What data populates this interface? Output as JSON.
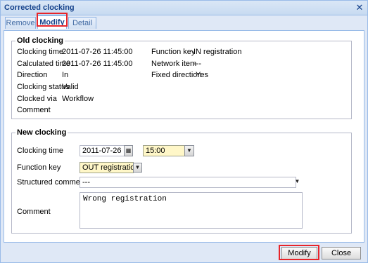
{
  "window": {
    "title": "Corrected clocking"
  },
  "tabs": [
    {
      "label": "Remove"
    },
    {
      "label": "Modify"
    },
    {
      "label": "Detail"
    }
  ],
  "old_clocking": {
    "legend": "Old clocking",
    "clocking_time_label": "Clocking time",
    "clocking_time_value": "2011-07-26 11:45:00",
    "calculated_time_label": "Calculated time",
    "calculated_time_value": "2011-07-26 11:45:00",
    "direction_label": "Direction",
    "direction_value": "In",
    "clocking_status_label": "Clocking status",
    "clocking_status_value": "Valid",
    "clocked_via_label": "Clocked via",
    "clocked_via_value": "Workflow",
    "comment_label": "Comment",
    "function_key_label": "Function key",
    "function_key_value": "IN registration",
    "network_item_label": "Network item",
    "network_item_value": "---",
    "fixed_direction_label": "Fixed direction",
    "fixed_direction_value": "Yes"
  },
  "new_clocking": {
    "legend": "New clocking",
    "clocking_time_label": "Clocking time",
    "date_value": "2011-07-26",
    "time_value": "15:00",
    "function_key_label": "Function key",
    "function_key_value": "OUT registration",
    "structured_comment_label": "Structured comment",
    "structured_comment_value": "---",
    "comment_label": "Comment",
    "comment_value": "Wrong registration"
  },
  "footer": {
    "modify_label": "Modify",
    "close_label": "Close"
  }
}
